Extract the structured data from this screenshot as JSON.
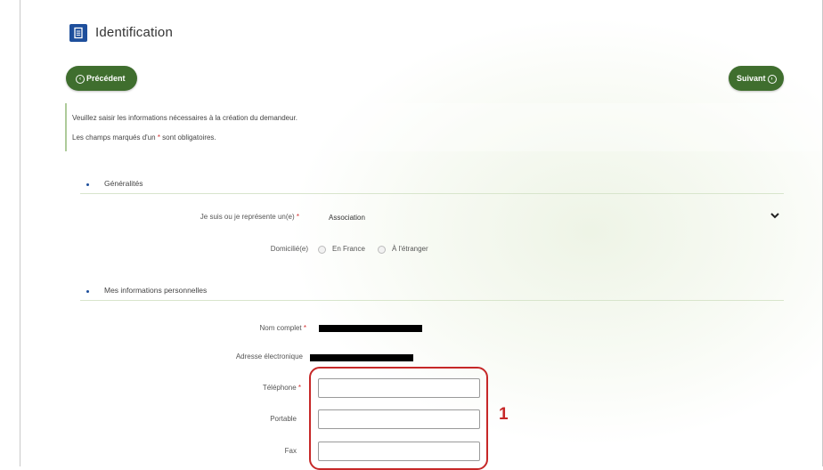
{
  "header": {
    "title": "Identification",
    "icon": "document-icon",
    "brand_color": "#1e4f9c"
  },
  "nav": {
    "prev_label": "Précédent",
    "next_label": "Suivant",
    "prev_icon": "circle-arrow-left-icon",
    "next_icon": "circle-arrow-right-icon",
    "button_color": "#3f6e2e"
  },
  "info": {
    "line1": "Veuillez saisir les informations nécessaires à la création du demandeur.",
    "line2_prefix": "Les champs marqués d'un",
    "line2_asterisk": "*",
    "line2_suffix": "sont obligatoires."
  },
  "sections": {
    "general": {
      "title": "Généralités",
      "represent_label": "Je suis ou je représente un(e)",
      "represent_required": "*",
      "represent_value": "Association",
      "domicile_label": "Domicilié(e)",
      "domicile_options": [
        "En France",
        "À l'étranger"
      ]
    },
    "personal": {
      "title": "Mes informations personnelles",
      "name_label": "Nom complet",
      "name_required": "*",
      "email_label": "Adresse électronique",
      "phone_label": "Téléphone",
      "phone_required": "*",
      "mobile_label": "Portable",
      "fax_label": "Fax"
    }
  },
  "annotation": {
    "number": "1",
    "color": "#c62828"
  }
}
